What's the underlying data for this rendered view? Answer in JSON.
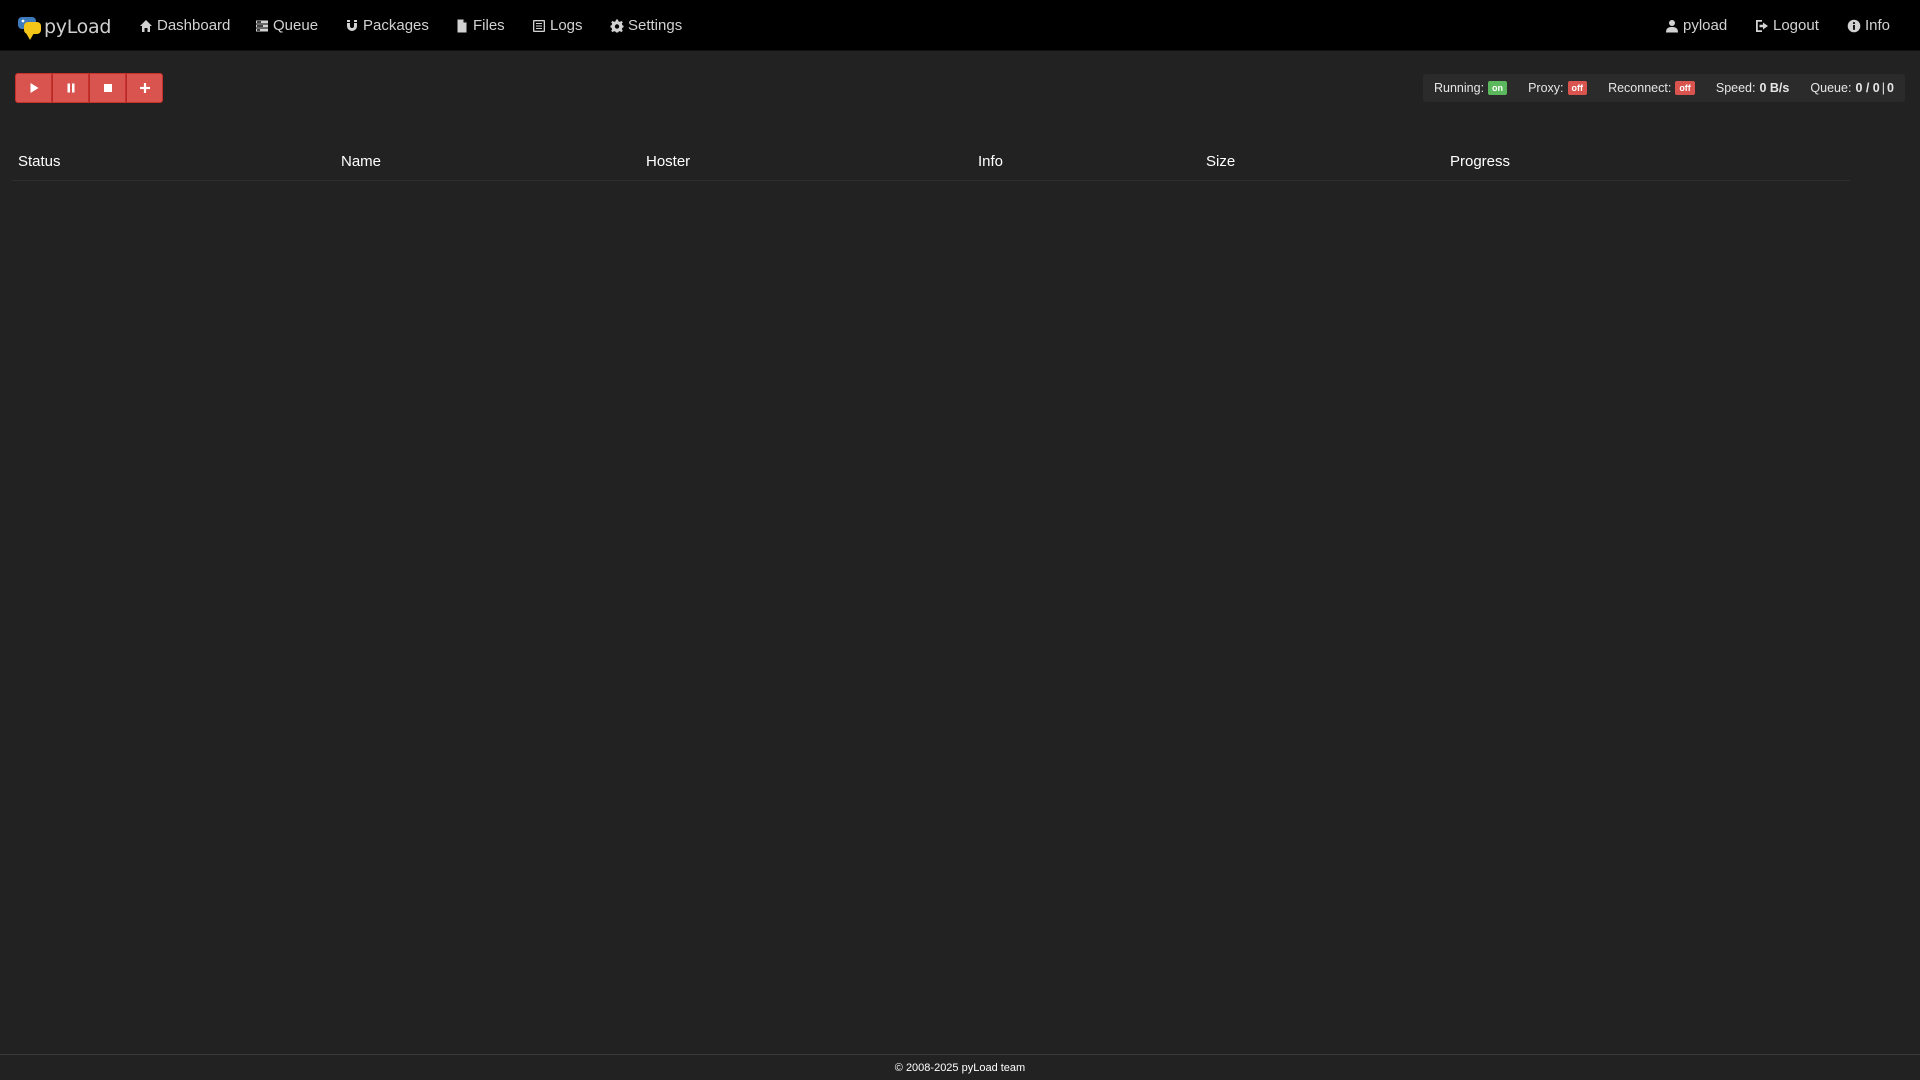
{
  "navbar": {
    "brand": "pyLoad",
    "items": [
      {
        "label": "Dashboard",
        "icon": "home-icon"
      },
      {
        "label": "Queue",
        "icon": "tasks-icon"
      },
      {
        "label": "Packages",
        "icon": "magnet-icon"
      },
      {
        "label": "Files",
        "icon": "file-icon"
      },
      {
        "label": "Logs",
        "icon": "list-alt-icon"
      },
      {
        "label": "Settings",
        "icon": "cog-icon"
      }
    ],
    "right": [
      {
        "label": "pyload",
        "icon": "user-icon"
      },
      {
        "label": "Logout",
        "icon": "logout-icon"
      },
      {
        "label": "Info",
        "icon": "info-icon"
      }
    ]
  },
  "toolbar": {
    "buttons": [
      {
        "icon": "play-icon"
      },
      {
        "icon": "pause-icon"
      },
      {
        "icon": "stop-icon"
      },
      {
        "icon": "plus-icon"
      }
    ],
    "color": "#d9534f"
  },
  "status": {
    "running_label": "Running:",
    "running_value": "on",
    "proxy_label": "Proxy:",
    "proxy_value": "off",
    "reconnect_label": "Reconnect:",
    "reconnect_value": "off",
    "speed_label": "Speed:",
    "speed_value": "0 B/s",
    "queue_label": "Queue:",
    "queue_value": "0 / 0",
    "queue_sep": "|",
    "queue_total": "0",
    "on_color": "#5cb85c",
    "off_color": "#d9534f"
  },
  "table": {
    "columns": [
      "Status",
      "Name",
      "Hoster",
      "Info",
      "Size",
      "Progress"
    ],
    "rows": []
  },
  "footer": {
    "text": "© 2008-2025 pyLoad team"
  }
}
